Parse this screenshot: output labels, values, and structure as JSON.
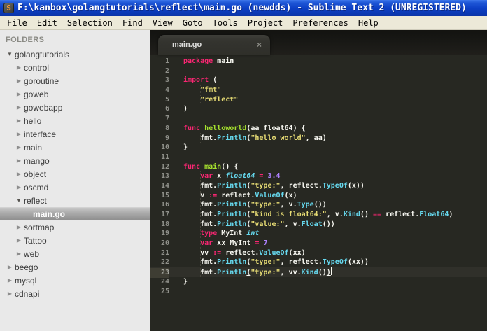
{
  "title_bar": {
    "title": "F:\\kanbox\\golangtutorials\\reflect\\main.go (newdds) - Sublime Text 2 (UNREGISTERED)"
  },
  "app_icon_glyph": "S",
  "menu_bar": {
    "items": [
      {
        "label": "File",
        "underline": 0
      },
      {
        "label": "Edit",
        "underline": 0
      },
      {
        "label": "Selection",
        "underline": 0
      },
      {
        "label": "Find",
        "underline": 2
      },
      {
        "label": "View",
        "underline": 0
      },
      {
        "label": "Goto",
        "underline": 0
      },
      {
        "label": "Tools",
        "underline": 0
      },
      {
        "label": "Project",
        "underline": 0
      },
      {
        "label": "Preferences",
        "underline": 7
      },
      {
        "label": "Help",
        "underline": 0
      }
    ]
  },
  "sidebar": {
    "header": "FOLDERS",
    "items": [
      {
        "label": "golangtutorials",
        "depth": 0,
        "state": "expanded"
      },
      {
        "label": "control",
        "depth": 1,
        "state": "collapsed"
      },
      {
        "label": "goroutine",
        "depth": 1,
        "state": "collapsed"
      },
      {
        "label": "goweb",
        "depth": 1,
        "state": "collapsed"
      },
      {
        "label": "gowebapp",
        "depth": 1,
        "state": "collapsed"
      },
      {
        "label": "hello",
        "depth": 1,
        "state": "collapsed"
      },
      {
        "label": "interface",
        "depth": 1,
        "state": "collapsed"
      },
      {
        "label": "main",
        "depth": 1,
        "state": "collapsed"
      },
      {
        "label": "mango",
        "depth": 1,
        "state": "collapsed"
      },
      {
        "label": "object",
        "depth": 1,
        "state": "collapsed"
      },
      {
        "label": "oscmd",
        "depth": 1,
        "state": "collapsed"
      },
      {
        "label": "reflect",
        "depth": 1,
        "state": "expanded"
      },
      {
        "label": "main.go",
        "depth": 2,
        "state": "file",
        "selected": true
      },
      {
        "label": "sortmap",
        "depth": 1,
        "state": "collapsed"
      },
      {
        "label": "Tattoo",
        "depth": 1,
        "state": "collapsed"
      },
      {
        "label": "web",
        "depth": 1,
        "state": "collapsed"
      },
      {
        "label": "beego",
        "depth": 0,
        "state": "collapsed"
      },
      {
        "label": "mysql",
        "depth": 0,
        "state": "collapsed"
      },
      {
        "label": "cdnapi",
        "depth": 0,
        "state": "collapsed"
      }
    ]
  },
  "icons": {
    "expanded_glyph": "▼",
    "collapsed_glyph": "▶"
  },
  "tab": {
    "label": "main.go",
    "close_glyph": "×"
  },
  "editor": {
    "lines": [
      {
        "num": 1,
        "segments": [
          [
            "package",
            "k"
          ],
          [
            " main",
            "p"
          ]
        ]
      },
      {
        "num": 2,
        "segments": []
      },
      {
        "num": 3,
        "segments": [
          [
            "import",
            "k"
          ],
          [
            " (",
            "p"
          ]
        ]
      },
      {
        "num": 4,
        "segments": [
          [
            "    ",
            "p"
          ],
          [
            "\"fmt\"",
            "s"
          ]
        ]
      },
      {
        "num": 5,
        "segments": [
          [
            "    ",
            "p"
          ],
          [
            "\"reflect\"",
            "s"
          ]
        ]
      },
      {
        "num": 6,
        "segments": [
          [
            ")",
            "p"
          ]
        ]
      },
      {
        "num": 7,
        "segments": []
      },
      {
        "num": 8,
        "segments": [
          [
            "func",
            "k"
          ],
          [
            " ",
            "p"
          ],
          [
            "helloworld",
            "f"
          ],
          [
            "(aa float64) {",
            "p"
          ]
        ]
      },
      {
        "num": 9,
        "segments": [
          [
            "    fmt.",
            "p"
          ],
          [
            "Println",
            "b"
          ],
          [
            "(",
            "p"
          ],
          [
            "\"hello world\"",
            "s"
          ],
          [
            ", aa)",
            "p"
          ]
        ]
      },
      {
        "num": 10,
        "segments": [
          [
            "}",
            "p"
          ]
        ]
      },
      {
        "num": 11,
        "segments": []
      },
      {
        "num": 12,
        "segments": [
          [
            "func",
            "k"
          ],
          [
            " ",
            "p"
          ],
          [
            "main",
            "f"
          ],
          [
            "() {",
            "p"
          ]
        ]
      },
      {
        "num": 13,
        "segments": [
          [
            "    ",
            "p"
          ],
          [
            "var",
            "k"
          ],
          [
            " x ",
            "p"
          ],
          [
            "float64",
            "bi"
          ],
          [
            " ",
            "p"
          ],
          [
            "=",
            "k"
          ],
          [
            " ",
            "p"
          ],
          [
            "3.4",
            "n"
          ]
        ]
      },
      {
        "num": 14,
        "segments": [
          [
            "    fmt.",
            "p"
          ],
          [
            "Println",
            "b"
          ],
          [
            "(",
            "p"
          ],
          [
            "\"type:\"",
            "s"
          ],
          [
            ", reflect.",
            "p"
          ],
          [
            "TypeOf",
            "b"
          ],
          [
            "(x))",
            "p"
          ]
        ]
      },
      {
        "num": 15,
        "segments": [
          [
            "    v ",
            "p"
          ],
          [
            ":=",
            "k"
          ],
          [
            " reflect.",
            "p"
          ],
          [
            "ValueOf",
            "b"
          ],
          [
            "(x)",
            "p"
          ]
        ]
      },
      {
        "num": 16,
        "segments": [
          [
            "    fmt.",
            "p"
          ],
          [
            "Println",
            "b"
          ],
          [
            "(",
            "p"
          ],
          [
            "\"type:\"",
            "s"
          ],
          [
            ", v.",
            "p"
          ],
          [
            "Type",
            "b"
          ],
          [
            "())",
            "p"
          ]
        ]
      },
      {
        "num": 17,
        "segments": [
          [
            "    fmt.",
            "p"
          ],
          [
            "Println",
            "b"
          ],
          [
            "(",
            "p"
          ],
          [
            "\"kind is float64:\"",
            "s"
          ],
          [
            ", v.",
            "p"
          ],
          [
            "Kind",
            "b"
          ],
          [
            "() ",
            "p"
          ],
          [
            "==",
            "k"
          ],
          [
            " reflect.",
            "p"
          ],
          [
            "Float64",
            "b"
          ],
          [
            ")",
            "p"
          ]
        ]
      },
      {
        "num": 18,
        "segments": [
          [
            "    fmt.",
            "p"
          ],
          [
            "Println",
            "b"
          ],
          [
            "(",
            "p"
          ],
          [
            "\"value:\"",
            "s"
          ],
          [
            ", v.",
            "p"
          ],
          [
            "Float",
            "b"
          ],
          [
            "())",
            "p"
          ]
        ]
      },
      {
        "num": 19,
        "segments": [
          [
            "    ",
            "p"
          ],
          [
            "type",
            "k"
          ],
          [
            " MyInt ",
            "p"
          ],
          [
            "int",
            "bi"
          ]
        ]
      },
      {
        "num": 20,
        "segments": [
          [
            "    ",
            "p"
          ],
          [
            "var",
            "k"
          ],
          [
            " xx MyInt ",
            "p"
          ],
          [
            "=",
            "k"
          ],
          [
            " ",
            "p"
          ],
          [
            "7",
            "n"
          ]
        ]
      },
      {
        "num": 21,
        "segments": [
          [
            "    vv ",
            "p"
          ],
          [
            ":=",
            "k"
          ],
          [
            " reflect.",
            "p"
          ],
          [
            "ValueOf",
            "b"
          ],
          [
            "(xx)",
            "p"
          ]
        ]
      },
      {
        "num": 22,
        "segments": [
          [
            "    fmt.",
            "p"
          ],
          [
            "Println",
            "b"
          ],
          [
            "(",
            "p"
          ],
          [
            "\"type:\"",
            "s"
          ],
          [
            ", reflect.",
            "p"
          ],
          [
            "TypeOf",
            "b"
          ],
          [
            "(xx))",
            "p"
          ]
        ]
      },
      {
        "num": 23,
        "segments": [
          [
            "    fmt.",
            "p"
          ],
          [
            "Println",
            "b"
          ],
          [
            "(",
            "pu"
          ],
          [
            "\"type:\"",
            "s"
          ],
          [
            ", vv.",
            "p"
          ],
          [
            "Kind",
            "b"
          ],
          [
            "()",
            "p"
          ],
          [
            ")",
            "pu"
          ]
        ],
        "current": true,
        "cursor": true
      },
      {
        "num": 24,
        "segments": [
          [
            "}",
            "p"
          ]
        ]
      },
      {
        "num": 25,
        "segments": []
      }
    ]
  },
  "colors": {
    "keyword": "#F92672",
    "function_name": "#A6E22E",
    "builtin": "#66D9EF",
    "string": "#E6DB74",
    "number": "#AE81FF",
    "plain": "#F8F8F2",
    "editor_bg": "#272822",
    "gutter_text": "#8F908A",
    "titlebar_blue": "#0d40c6",
    "menubar_bg": "#ECE9D8",
    "sidebar_bg": "#E9E9E9"
  }
}
